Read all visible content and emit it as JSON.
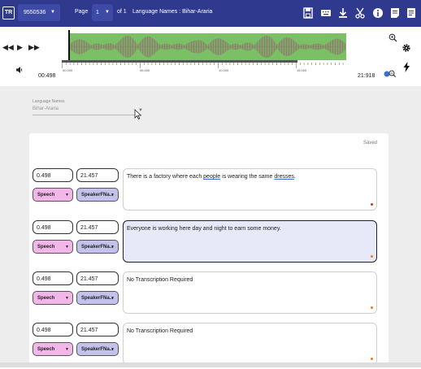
{
  "header": {
    "mode_badge": "TR",
    "file_id": "9550536",
    "page_label": "Page",
    "page_value": "1",
    "page_of": "of 1",
    "title": "Language Names : Bihar-Araria",
    "icons": [
      "save-icon",
      "keyboard-icon",
      "download-icon",
      "scissors-icon",
      "info-icon",
      "notes-icon",
      "checklist-icon"
    ],
    "bar_color": "#2f3a8f"
  },
  "player": {
    "controls": [
      "rewind-icon",
      "play-icon",
      "fast-forward-icon",
      "volume-icon"
    ],
    "current_time": "00:498",
    "total_time": "21:918",
    "ticks": [
      "00.000",
      "05.000",
      "10.000",
      "15.000"
    ],
    "waveform_color": "#7cc065"
  },
  "language_field": {
    "label": "Language Names",
    "value": "Bihar-Araria"
  },
  "status": "Saved",
  "segments": [
    {
      "start": "0.498",
      "end": "21.457",
      "type": "Speech",
      "speaker": "SpeakerFNa...",
      "parts": [
        "There is a factory where each ",
        "people",
        " is wearing the same ",
        "dresses",
        "."
      ],
      "dot_color": "#c0392b",
      "active": false
    },
    {
      "start": "0.498",
      "end": "21.457",
      "type": "Speech",
      "speaker": "SpeakerFNa...",
      "parts": [
        "Everyone is working here day and night to earn some money.",
        "",
        "",
        "",
        ""
      ],
      "dot_color": "#e67e22",
      "active": true
    },
    {
      "start": "0.498",
      "end": "21.457",
      "type": "Speech",
      "speaker": "SpeakerFNa...",
      "parts": [
        "No Transcription Required",
        "",
        "",
        "",
        ""
      ],
      "dot_color": "#e67e22",
      "active": false
    },
    {
      "start": "0.498",
      "end": "21.457",
      "type": "Speech",
      "speaker": "SpeakerFNa...",
      "parts": [
        "No Transcription Required",
        "",
        "",
        "",
        ""
      ],
      "dot_color": "#e67e22",
      "active": false
    }
  ]
}
